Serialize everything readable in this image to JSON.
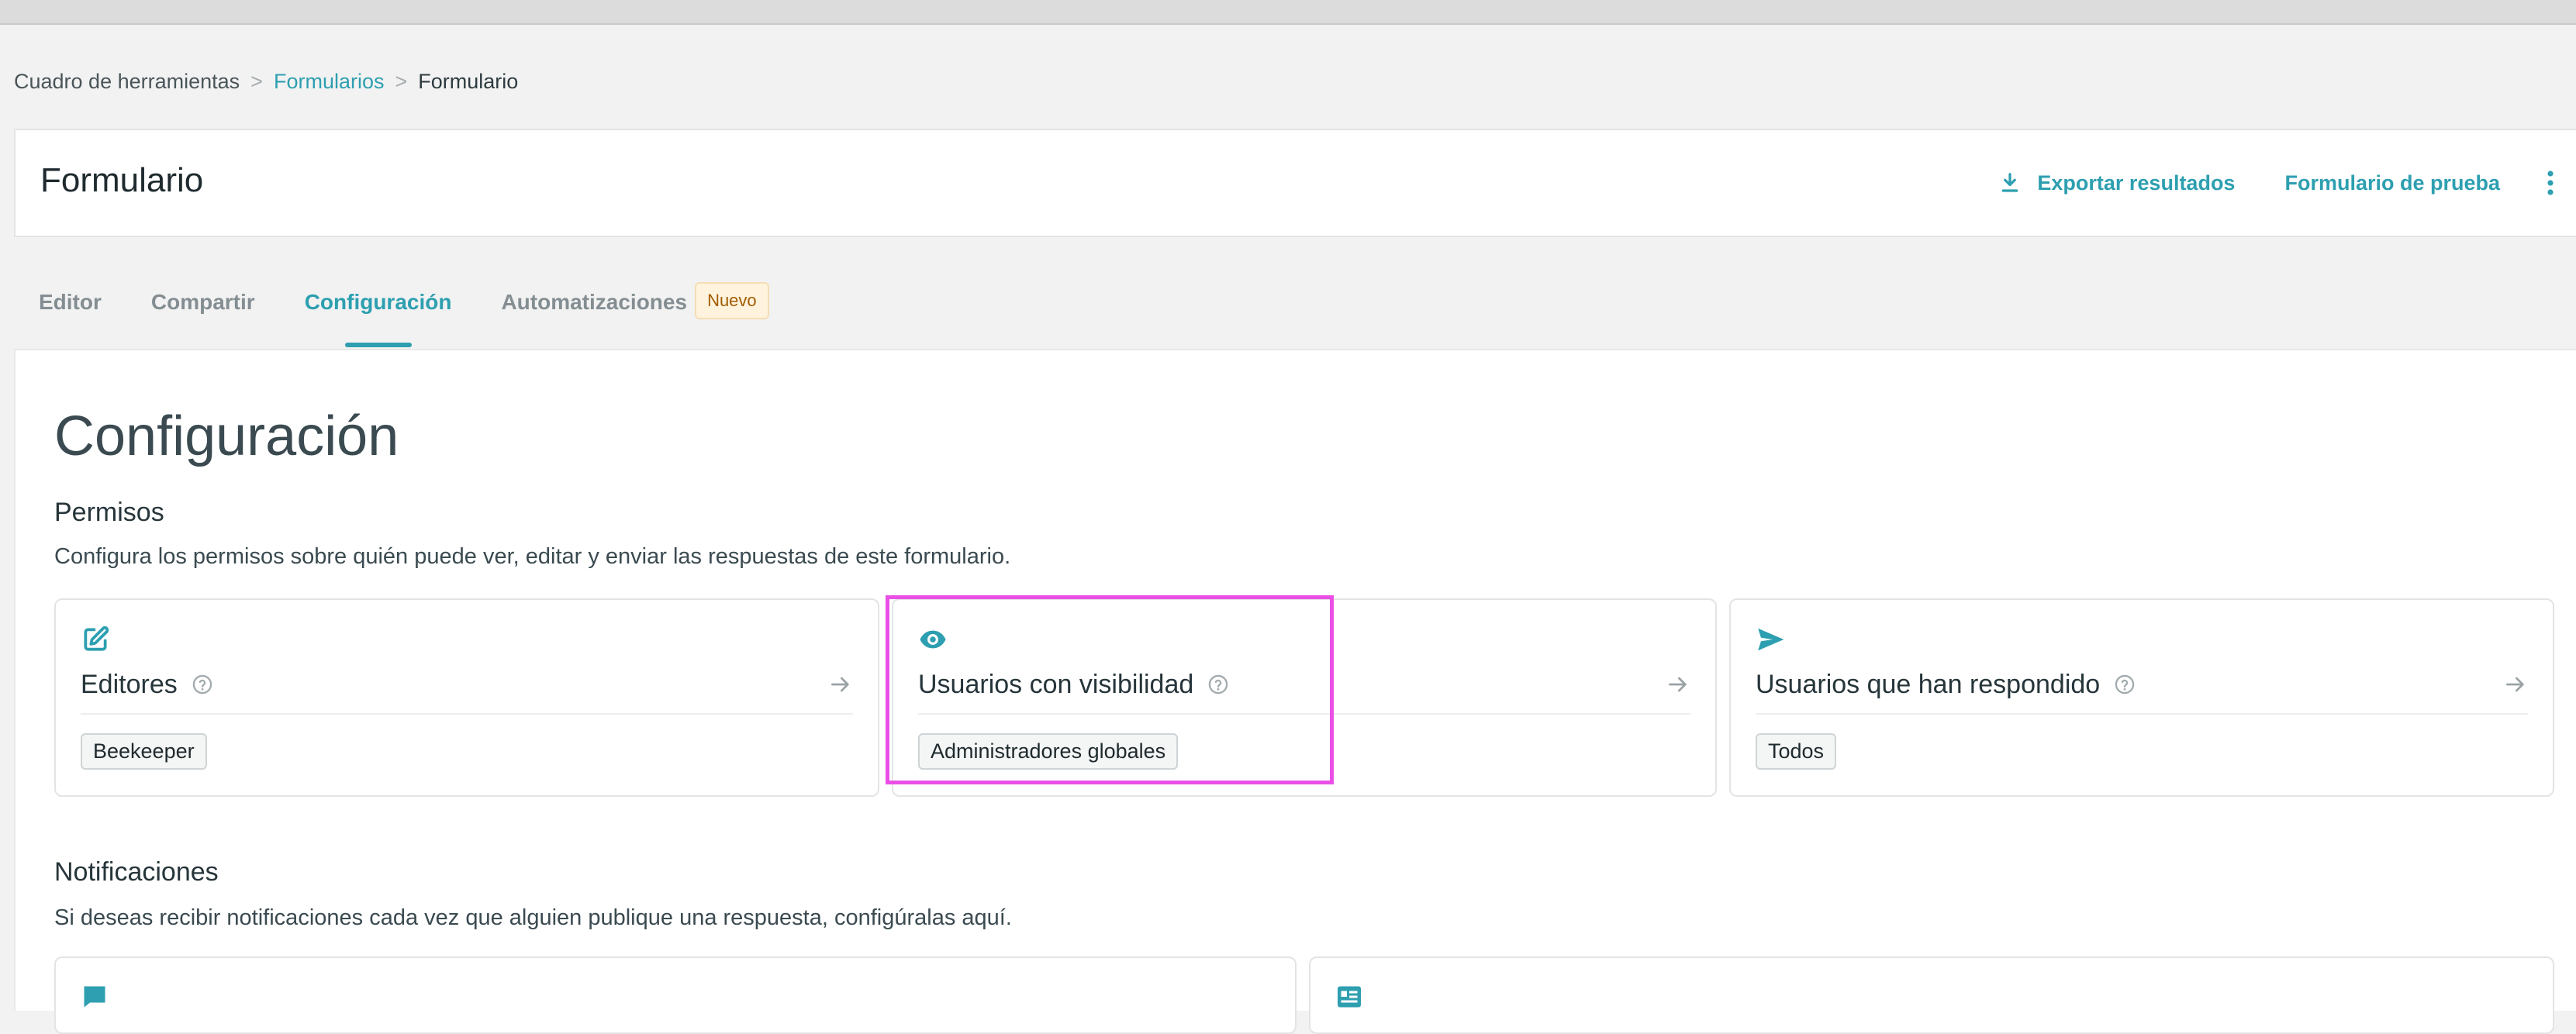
{
  "breadcrumb": {
    "items": [
      "Cuadro de herramientas",
      "Formularios",
      "Formulario"
    ],
    "separator": ">"
  },
  "header": {
    "title": "Formulario",
    "export_label": "Exportar resultados",
    "test_label": "Formulario de prueba"
  },
  "tabs": [
    {
      "label": "Editor"
    },
    {
      "label": "Compartir"
    },
    {
      "label": "Configuración",
      "active": true
    },
    {
      "label": "Automatizaciones",
      "badge": "Nuevo"
    }
  ],
  "main": {
    "title": "Configuración",
    "permissions": {
      "heading": "Permisos",
      "description": "Configura los permisos sobre quién puede ver, editar y enviar las respuestas de este formulario.",
      "cards": [
        {
          "title": "Editores",
          "tag": "Beekeeper",
          "icon": "edit-icon"
        },
        {
          "title": "Usuarios con visibilidad",
          "tag": "Administradores globales",
          "icon": "eye-icon",
          "highlighted": true
        },
        {
          "title": "Usuarios que han respondido",
          "tag": "Todos",
          "icon": "send-icon"
        }
      ]
    },
    "notifications": {
      "heading": "Notificaciones",
      "description": "Si deseas recibir notificaciones cada vez que alguien publique una respuesta, configúralas aquí.",
      "cards": [
        {
          "icon": "chat-icon"
        },
        {
          "icon": "newspaper-icon"
        }
      ]
    }
  },
  "colors": {
    "accent": "#2d9fb0",
    "highlight": "#ea4fe6",
    "badge_bg": "#fff3de",
    "badge_text": "#a15c00"
  }
}
